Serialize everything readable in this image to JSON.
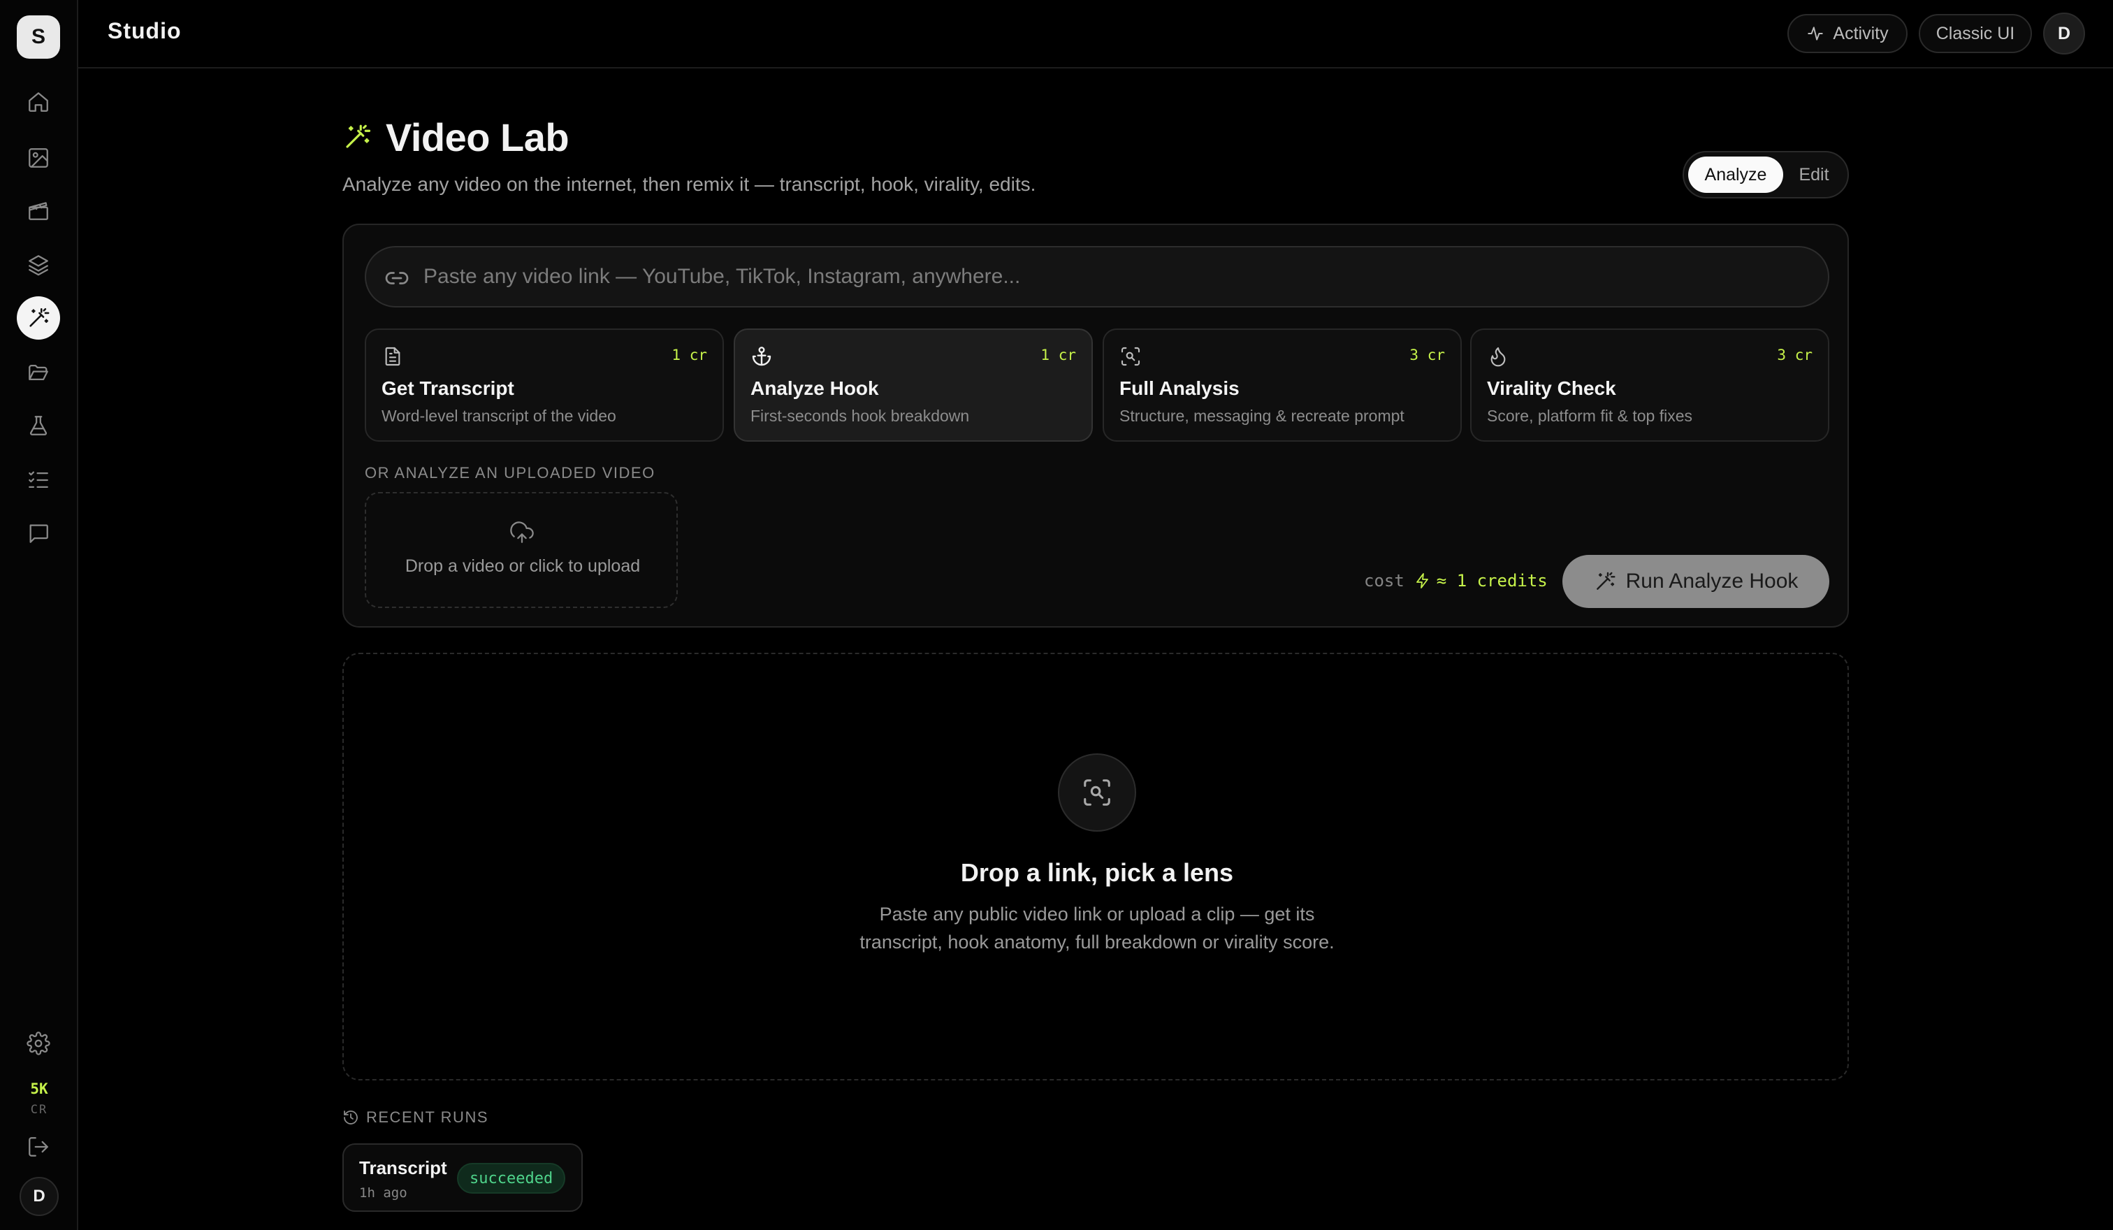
{
  "app": {
    "logo_letter": "S",
    "title": "Studio"
  },
  "sidebar": {
    "items": [
      {
        "name": "home",
        "icon": "home-icon",
        "active": false
      },
      {
        "name": "images",
        "icon": "image-icon",
        "active": false
      },
      {
        "name": "video",
        "icon": "clapperboard-icon",
        "active": false
      },
      {
        "name": "layers",
        "icon": "layers-icon",
        "active": false
      },
      {
        "name": "video-lab",
        "icon": "magic-wand-icon",
        "active": true
      },
      {
        "name": "folder",
        "icon": "folder-open-icon",
        "active": false
      },
      {
        "name": "lab",
        "icon": "flask-icon",
        "active": false
      },
      {
        "name": "tasks",
        "icon": "checklist-icon",
        "active": false
      },
      {
        "name": "chat",
        "icon": "chat-icon",
        "active": false
      }
    ],
    "credits_value": "5K",
    "credits_unit": "CR",
    "avatar_letter": "D"
  },
  "topbar": {
    "activity_label": "Activity",
    "classic_label": "Classic UI",
    "avatar_letter": "D"
  },
  "header": {
    "title": "Video Lab",
    "subtitle": "Analyze any video on the internet, then remix it — transcript, hook, virality, edits.",
    "mode_toggle": {
      "options": [
        "Analyze",
        "Edit"
      ],
      "selected": "Analyze"
    }
  },
  "input": {
    "placeholder": "Paste any video link — YouTube, TikTok, Instagram, anywhere...",
    "value": ""
  },
  "lenses": [
    {
      "icon": "document-icon",
      "name": "Get Transcript",
      "desc": "Word-level transcript of the video",
      "cost": "1 cr",
      "selected": false
    },
    {
      "icon": "anchor-icon",
      "name": "Analyze Hook",
      "desc": "First-seconds hook breakdown",
      "cost": "1 cr",
      "selected": true
    },
    {
      "icon": "scan-search-icon",
      "name": "Full Analysis",
      "desc": "Structure, messaging & recreate prompt",
      "cost": "3 cr",
      "selected": false
    },
    {
      "icon": "flame-icon",
      "name": "Virality Check",
      "desc": "Score, platform fit & top fixes",
      "cost": "3 cr",
      "selected": false
    }
  ],
  "upload": {
    "section_label": "OR ANALYZE AN UPLOADED VIDEO",
    "text": "Drop a video or click to upload"
  },
  "cost": {
    "label": "cost",
    "value": "≈ 1 credits"
  },
  "run_button": {
    "label": "Run Analyze Hook"
  },
  "empty_state": {
    "title": "Drop a link, pick a lens",
    "description": "Paste any public video link or upload a clip — get its transcript, hook anatomy, full breakdown or virality score."
  },
  "recent_runs": {
    "label": "RECENT RUNS",
    "items": [
      {
        "name": "Transcript",
        "time": "1h ago",
        "status": "succeeded"
      }
    ]
  },
  "colors": {
    "background": "#000000",
    "accent_credit": "#c6f24a",
    "success": "#4fd48b",
    "run_button": "#8c8c8c"
  }
}
